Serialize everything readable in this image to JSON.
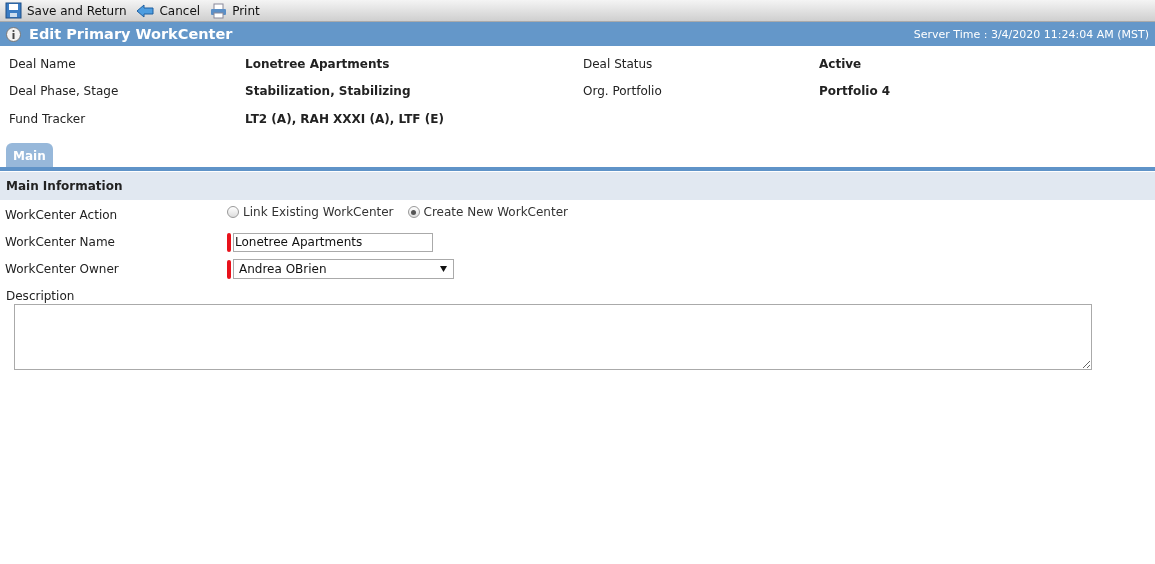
{
  "toolbar": [
    {
      "kind": "save",
      "label": "Save and Return"
    },
    {
      "kind": "cancel",
      "label": "Cancel"
    },
    {
      "kind": "print",
      "label": "Print"
    }
  ],
  "header": {
    "title": "Edit Primary WorkCenter",
    "server_time": "Server Time : 3/4/2020 11:24:04 AM (MST)"
  },
  "deal_fields": [
    {
      "label": "Deal Name",
      "value": "Lonetree Apartments"
    },
    {
      "label": "Deal Status",
      "value": "Active"
    },
    {
      "label": "Deal Phase, Stage",
      "value": "Stabilization, Stabilizing"
    },
    {
      "label": "Org. Portfolio",
      "value": "Portfolio 4"
    },
    {
      "label": "Fund Tracker",
      "value": "LT2 (A), RAH XXXI (A), LTF (E)"
    }
  ],
  "tabs": [
    {
      "label": "Main",
      "selected": true
    }
  ],
  "section": {
    "title": "Main Information"
  },
  "action": {
    "label": "WorkCenter Action",
    "options": [
      {
        "label": "Link Existing WorkCenter",
        "selected": false
      },
      {
        "label": "Create New WorkCenter",
        "selected": true
      }
    ]
  },
  "name_field": {
    "label": "WorkCenter Name",
    "value": "Lonetree Apartments",
    "required": true
  },
  "owner_field": {
    "label": "WorkCenter Owner",
    "value": "Andrea OBrien",
    "required": true
  },
  "description": {
    "label": "Description"
  }
}
